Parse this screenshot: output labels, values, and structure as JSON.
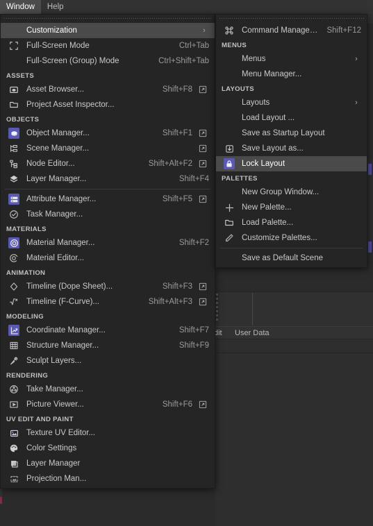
{
  "app": {
    "accent_purple": "#5a5ab4",
    "menu_bg": "#252525",
    "selected_row_bg": "#4a4a4a",
    "background_bg": "#2b2b2b"
  },
  "menubar": {
    "items": [
      {
        "label": "Window",
        "active": true
      },
      {
        "label": "Help",
        "active": false
      }
    ]
  },
  "background": {
    "obscured_menubar_text": "...  ...  ...  ...  ...  ...",
    "tabs": [
      {
        "label": "dit"
      },
      {
        "label": "User Data"
      }
    ]
  },
  "window_menu": {
    "rows": [
      {
        "kind": "item",
        "label": "Customization",
        "shortcut": "",
        "icon": "",
        "submenu": true,
        "selected": true,
        "popout": false
      },
      {
        "kind": "item",
        "label": "Full-Screen Mode",
        "shortcut": "Ctrl+Tab",
        "icon": "fullscreen-icon",
        "submenu": false,
        "selected": false,
        "popout": false
      },
      {
        "kind": "item",
        "label": "Full-Screen (Group) Mode",
        "shortcut": "Ctrl+Shift+Tab",
        "icon": "",
        "submenu": false,
        "selected": false,
        "popout": false
      },
      {
        "kind": "section",
        "label": "ASSETS"
      },
      {
        "kind": "item",
        "label": "Asset Browser...",
        "shortcut": "Shift+F8",
        "icon": "asset-browser-icon",
        "submenu": false,
        "selected": false,
        "popout": true
      },
      {
        "kind": "item",
        "label": "Project Asset Inspector...",
        "shortcut": "",
        "icon": "folder-icon",
        "submenu": false,
        "selected": false,
        "popout": false
      },
      {
        "kind": "section",
        "label": "OBJECTS"
      },
      {
        "kind": "item",
        "label": "Object Manager...",
        "shortcut": "Shift+F1",
        "icon": "object-manager-icon",
        "submenu": false,
        "selected": false,
        "popout": true,
        "chip": true
      },
      {
        "kind": "item",
        "label": "Scene Manager...",
        "shortcut": "",
        "icon": "scene-manager-icon",
        "submenu": false,
        "selected": false,
        "popout": true
      },
      {
        "kind": "item",
        "label": "Node Editor...",
        "shortcut": "Shift+Alt+F2",
        "icon": "node-editor-icon",
        "submenu": false,
        "selected": false,
        "popout": true
      },
      {
        "kind": "item",
        "label": "Layer Manager...",
        "shortcut": "Shift+F4",
        "icon": "layers-icon",
        "submenu": false,
        "selected": false,
        "popout": false
      },
      {
        "kind": "separator"
      },
      {
        "kind": "item",
        "label": "Attribute Manager...",
        "shortcut": "Shift+F5",
        "icon": "attribute-manager-icon",
        "submenu": false,
        "selected": false,
        "popout": true,
        "chip": true
      },
      {
        "kind": "item",
        "label": "Task Manager...",
        "shortcut": "",
        "icon": "task-manager-icon",
        "submenu": false,
        "selected": false,
        "popout": false
      },
      {
        "kind": "section",
        "label": "MATERIALS"
      },
      {
        "kind": "item",
        "label": "Material Manager...",
        "shortcut": "Shift+F2",
        "icon": "material-manager-icon",
        "submenu": false,
        "selected": false,
        "popout": false,
        "chip": true
      },
      {
        "kind": "item",
        "label": "Material Editor...",
        "shortcut": "",
        "icon": "material-editor-icon",
        "submenu": false,
        "selected": false,
        "popout": false
      },
      {
        "kind": "section",
        "label": "ANIMATION"
      },
      {
        "kind": "item",
        "label": "Timeline (Dope Sheet)...",
        "shortcut": "Shift+F3",
        "icon": "dope-sheet-icon",
        "submenu": false,
        "selected": false,
        "popout": true
      },
      {
        "kind": "item",
        "label": "Timeline (F-Curve)...",
        "shortcut": "Shift+Alt+F3",
        "icon": "f-curve-icon",
        "submenu": false,
        "selected": false,
        "popout": true
      },
      {
        "kind": "section",
        "label": "MODELING"
      },
      {
        "kind": "item",
        "label": "Coordinate Manager...",
        "shortcut": "Shift+F7",
        "icon": "coordinate-manager-icon",
        "submenu": false,
        "selected": false,
        "popout": false,
        "chip": true
      },
      {
        "kind": "item",
        "label": "Structure Manager...",
        "shortcut": "Shift+F9",
        "icon": "structure-manager-icon",
        "submenu": false,
        "selected": false,
        "popout": false
      },
      {
        "kind": "item",
        "label": "Sculpt Layers...",
        "shortcut": "",
        "icon": "sculpt-icon",
        "submenu": false,
        "selected": false,
        "popout": false
      },
      {
        "kind": "section",
        "label": "RENDERING"
      },
      {
        "kind": "item",
        "label": "Take Manager...",
        "shortcut": "",
        "icon": "take-manager-icon",
        "submenu": false,
        "selected": false,
        "popout": false
      },
      {
        "kind": "item",
        "label": "Picture Viewer...",
        "shortcut": "Shift+F6",
        "icon": "picture-viewer-icon",
        "submenu": false,
        "selected": false,
        "popout": true
      },
      {
        "kind": "section",
        "label": "UV EDIT AND PAINT"
      },
      {
        "kind": "item",
        "label": "Texture UV Editor...",
        "shortcut": "",
        "icon": "texture-uv-icon",
        "submenu": false,
        "selected": false,
        "popout": false
      },
      {
        "kind": "item",
        "label": "Color Settings",
        "shortcut": "",
        "icon": "palette-icon",
        "submenu": false,
        "selected": false,
        "popout": false
      },
      {
        "kind": "item",
        "label": "Layer Manager",
        "shortcut": "",
        "icon": "paint-layer-icon",
        "submenu": false,
        "selected": false,
        "popout": false
      },
      {
        "kind": "item",
        "label": "Projection Man...",
        "shortcut": "",
        "icon": "projection-icon",
        "submenu": false,
        "selected": false,
        "popout": false
      }
    ]
  },
  "customization_menu": {
    "rows": [
      {
        "kind": "item",
        "label": "Command Manager...",
        "shortcut": "Shift+F12",
        "icon": "command-icon",
        "submenu": false,
        "selected": false
      },
      {
        "kind": "section",
        "label": "MENUS"
      },
      {
        "kind": "item",
        "label": "Menus",
        "shortcut": "",
        "icon": "",
        "submenu": true,
        "selected": false
      },
      {
        "kind": "item",
        "label": "Menu Manager...",
        "shortcut": "",
        "icon": "",
        "submenu": false,
        "selected": false
      },
      {
        "kind": "section",
        "label": "LAYOUTS"
      },
      {
        "kind": "item",
        "label": "Layouts",
        "shortcut": "",
        "icon": "",
        "submenu": true,
        "selected": false
      },
      {
        "kind": "item",
        "label": "Load Layout ...",
        "shortcut": "",
        "icon": "",
        "submenu": false,
        "selected": false
      },
      {
        "kind": "item",
        "label": "Save as Startup Layout",
        "shortcut": "",
        "icon": "",
        "submenu": false,
        "selected": false
      },
      {
        "kind": "item",
        "label": "Save Layout as...",
        "shortcut": "",
        "icon": "save-layout-icon",
        "submenu": false,
        "selected": false
      },
      {
        "kind": "item",
        "label": "Lock Layout",
        "shortcut": "",
        "icon": "lock-icon",
        "submenu": false,
        "selected": true,
        "chip": true
      },
      {
        "kind": "section",
        "label": "PALETTES"
      },
      {
        "kind": "item",
        "label": "New Group Window...",
        "shortcut": "",
        "icon": "",
        "submenu": false,
        "selected": false
      },
      {
        "kind": "item",
        "label": "New Palette...",
        "shortcut": "",
        "icon": "plus-icon",
        "submenu": false,
        "selected": false
      },
      {
        "kind": "item",
        "label": "Load Palette...",
        "shortcut": "",
        "icon": "folder-icon",
        "submenu": false,
        "selected": false
      },
      {
        "kind": "item",
        "label": "Customize Palettes...",
        "shortcut": "",
        "icon": "pencil-icon",
        "submenu": false,
        "selected": false
      },
      {
        "kind": "separator"
      },
      {
        "kind": "item",
        "label": "Save as Default Scene",
        "shortcut": "",
        "icon": "",
        "submenu": false,
        "selected": false
      }
    ]
  }
}
